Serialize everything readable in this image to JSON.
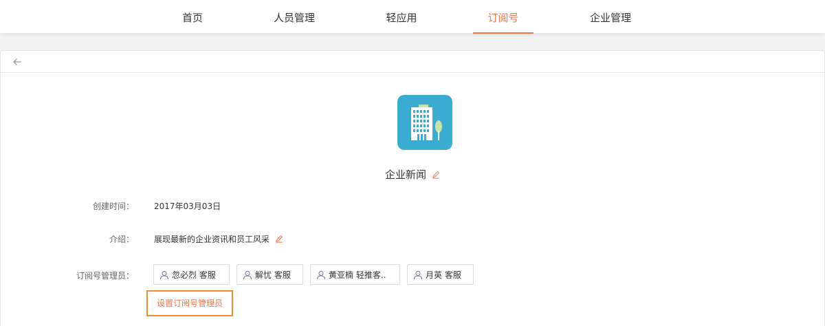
{
  "nav": {
    "items": [
      {
        "label": "首页"
      },
      {
        "label": "人员管理"
      },
      {
        "label": "轻应用"
      },
      {
        "label": "订阅号"
      },
      {
        "label": "企业管理"
      }
    ],
    "active_index": 3
  },
  "subscription": {
    "name": "企业新闻",
    "fields": {
      "created_label": "创建时间：",
      "created_value": "2017年03月03日",
      "intro_label": "介绍：",
      "intro_value": "展现最新的企业资讯和员工风采",
      "admins_label": "订阅号管理员："
    },
    "admins": [
      {
        "label": "忽必烈 客服"
      },
      {
        "label": "解忧 客服"
      },
      {
        "label": "黄亚楠 轻推客.."
      },
      {
        "label": "月英 客服"
      }
    ],
    "set_admin_label": "设置订阅号管理员"
  },
  "colors": {
    "accent": "#f0764a",
    "highlight_border": "#f28a2e",
    "app_icon_bg": "#3bacd1",
    "user_icon": "#7c84b8"
  },
  "icons": {
    "back": "left-arrow-icon",
    "edit": "pencil-icon",
    "user": "user-icon",
    "app": "building-icon"
  }
}
